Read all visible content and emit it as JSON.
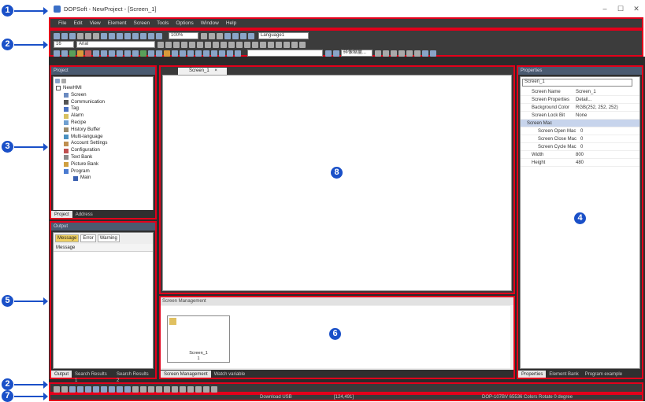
{
  "window": {
    "title": "DOPSoft - NewProject - [Screen_1]",
    "minimize": "–",
    "maximize": "☐",
    "close": "✕"
  },
  "menu": [
    "File",
    "Edit",
    "View",
    "Element",
    "Screen",
    "Tools",
    "Options",
    "Window",
    "Help"
  ],
  "toolbar": {
    "zoom": "100%",
    "language": "Language1",
    "font_size": "16",
    "font_name": "Arial",
    "style_select": "碎像缩量..."
  },
  "project_panel": {
    "header": "Project",
    "tree": [
      "NewHMI",
      "Screen",
      "Communication",
      "Tag",
      "Alarm",
      "Recipe",
      "History Buffer",
      "Multi-language",
      "Account Settings",
      "Configuration",
      "Text Bank",
      "Picture Bank",
      "Program",
      "Main"
    ],
    "tabs": [
      "Project",
      "Address"
    ]
  },
  "output_panel": {
    "header": "Output",
    "filters": [
      "Message",
      "Error",
      "Warning"
    ],
    "column": "Message",
    "tabs": [
      "Output",
      "Search Results 1",
      "Search Results 2"
    ]
  },
  "editor": {
    "tab": "Screen_1",
    "tab_close": "×"
  },
  "screen_mgmt": {
    "header": "Screen Management",
    "thumb_label": "Screen_1",
    "thumb_num": "1",
    "tabs": [
      "Screen Management",
      "Watch variable"
    ]
  },
  "properties": {
    "header": "Properties",
    "selector": "Screen_1",
    "rows": [
      {
        "k": "Screen Name",
        "v": "Screen_1"
      },
      {
        "k": "Screen Properties",
        "v": "Detail..."
      },
      {
        "k": "Background Color",
        "v": "RGB(252, 252, 252)"
      },
      {
        "k": "Screen Lock Bit",
        "v": "None"
      }
    ],
    "macro_group": "Screen Mac",
    "macro_rows": [
      {
        "k": "Screen Open Mac",
        "v": "0"
      },
      {
        "k": "Screen Close Mac",
        "v": "0"
      },
      {
        "k": "Screen Cycle Mac",
        "v": "0"
      }
    ],
    "size_rows": [
      {
        "k": "Width",
        "v": "800"
      },
      {
        "k": "Height",
        "v": "480"
      }
    ],
    "tabs": [
      "Properties",
      "Element Bank",
      "Program example"
    ]
  },
  "status": {
    "download": "Download USB",
    "coords": "[124,491]",
    "device": "DOP-107BV 65536 Colors Rotate 0 degree"
  },
  "markers": [
    "1",
    "2",
    "3",
    "4",
    "5",
    "6",
    "7",
    "8",
    "2"
  ],
  "colors": {
    "marker": "#1a50c8",
    "highlight": "#e3001b"
  }
}
